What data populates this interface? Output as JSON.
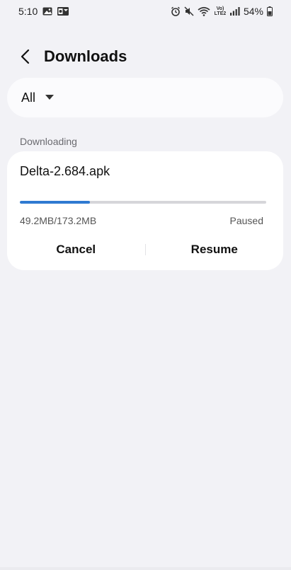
{
  "status_bar": {
    "time": "5:10",
    "battery": "54%",
    "network_label": "Vo) LTE2"
  },
  "header": {
    "title": "Downloads"
  },
  "filter": {
    "selected": "All"
  },
  "section": {
    "label": "Downloading"
  },
  "download": {
    "file_name": "Delta-2.684.apk",
    "size_text": "49.2MB/173.2MB",
    "status": "Paused",
    "progress_fraction": 0.284,
    "accent_color": "#2f7ad1",
    "cancel_label": "Cancel",
    "resume_label": "Resume"
  }
}
